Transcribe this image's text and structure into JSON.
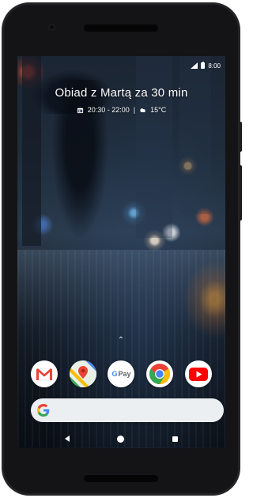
{
  "status_bar": {
    "time": "8:00",
    "signal_icon": "cell-signal-icon",
    "battery_icon": "battery-icon"
  },
  "at_a_glance": {
    "event_title": "Obiad z Martą za 30 min",
    "event_time": "20:30 - 22:00",
    "separator": "|",
    "temperature": "15°C",
    "calendar_icon": "calendar-icon",
    "weather_icon": "cloudy-weather-icon"
  },
  "dock": {
    "apps": [
      {
        "name": "Gmail",
        "icon": "gmail-icon"
      },
      {
        "name": "Maps",
        "icon": "google-maps-icon"
      },
      {
        "name": "Google Pay",
        "icon": "gpay-icon",
        "label": "Pay"
      },
      {
        "name": "Chrome",
        "icon": "chrome-icon"
      },
      {
        "name": "YouTube",
        "icon": "youtube-icon"
      }
    ]
  },
  "search": {
    "icon": "google-g-icon"
  },
  "nav": {
    "back": "back-icon",
    "home": "home-icon",
    "recents": "recents-icon"
  },
  "colors": {
    "google_blue": "#4285F4",
    "google_red": "#EA4335",
    "google_yellow": "#FBBC05",
    "google_green": "#34A853",
    "youtube_red": "#FF0000",
    "phone_body": "#141416",
    "search_bg": "#eceff1"
  }
}
